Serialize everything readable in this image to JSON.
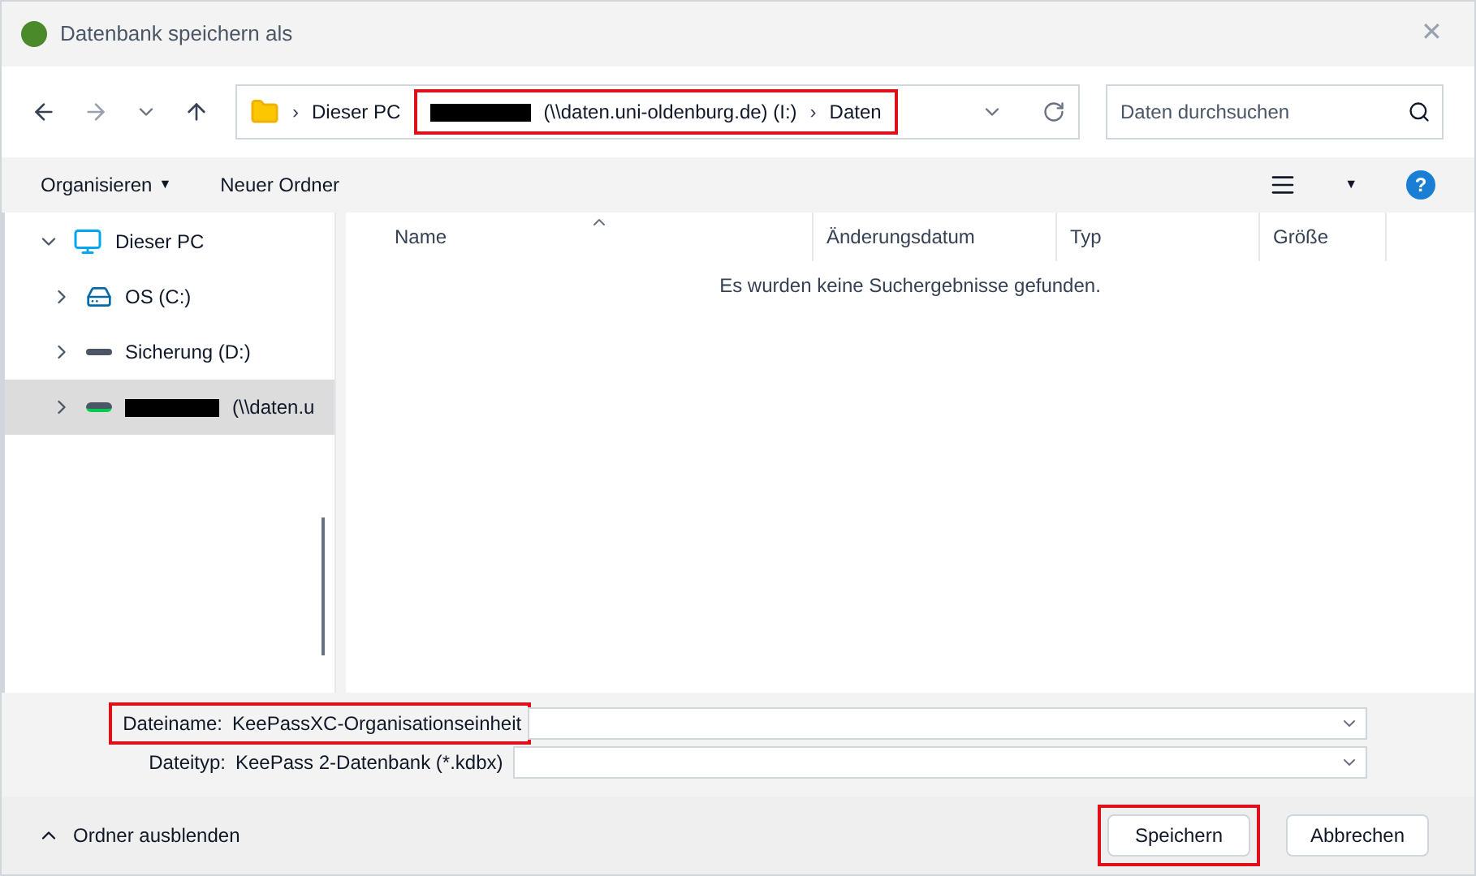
{
  "window": {
    "title": "Datenbank speichern als",
    "close": "✕"
  },
  "address": {
    "segments": [
      {
        "separator": "›",
        "label": "Dieser PC",
        "redacted": false,
        "highlighted": false
      },
      {
        "label": "(\\\\daten.uni-oldenburg.de) (I:)",
        "redacted": true,
        "highlighted": true
      },
      {
        "separator": "›",
        "label": "Daten",
        "redacted": false,
        "highlighted": true
      }
    ]
  },
  "search": {
    "placeholder": "Daten durchsuchen"
  },
  "toolbar": {
    "organize": "Organisieren",
    "organize_caret": "▼",
    "new_folder": "Neuer Ordner",
    "view_caret": "▼",
    "help": "?"
  },
  "sidebar": {
    "items": [
      {
        "label": "Dieser PC",
        "kind": "computer",
        "expanded": true,
        "selected": false,
        "redacted": false,
        "children": [
          {
            "label": "OS (C:)",
            "kind": "os-drive",
            "expanded": false,
            "selected": false,
            "redacted": false
          },
          {
            "label": "Sicherung (D:)",
            "kind": "drive",
            "expanded": false,
            "selected": false,
            "redacted": false
          },
          {
            "label": "(\\\\daten.u",
            "kind": "network-drive",
            "expanded": false,
            "selected": true,
            "redacted": true
          }
        ]
      }
    ]
  },
  "table": {
    "columns": [
      "Name",
      "Änderungsdatum",
      "Typ",
      "Größe"
    ],
    "empty_message": "Es wurden keine Suchergebnisse gefunden."
  },
  "fields": [
    {
      "label": "Dateiname:",
      "value": "KeePassXC-Organisationseinheit",
      "highlighted": true
    },
    {
      "label": "Dateityp:",
      "value": "KeePass 2-Datenbank (*.kdbx)",
      "highlighted": false
    }
  ],
  "footer": {
    "toggle": "Ordner ausblenden",
    "buttons": [
      {
        "label": "Speichern",
        "highlighted": true
      },
      {
        "label": "Abbrechen",
        "highlighted": false
      }
    ]
  }
}
